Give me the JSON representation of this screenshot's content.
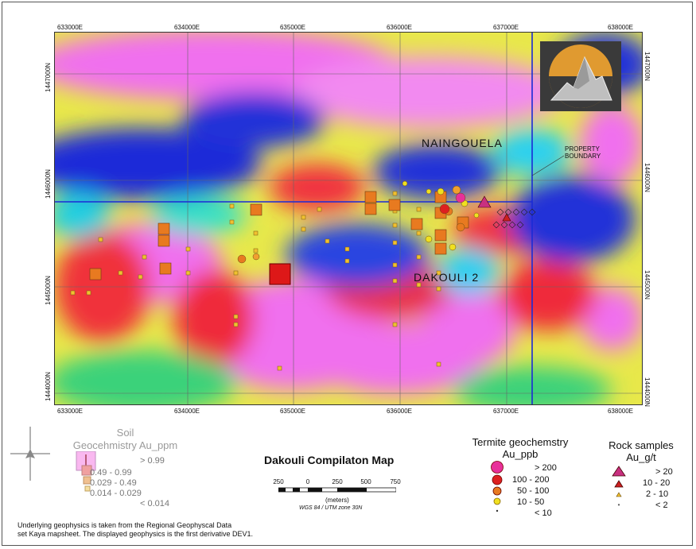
{
  "map": {
    "title": "Dakouli Compilaton Map",
    "eastings_top": [
      "633000E",
      "634000E",
      "635000E",
      "636000E",
      "637000E",
      "638000E"
    ],
    "eastings_bottom": [
      "633000E",
      "634000E",
      "635000E",
      "636000E",
      "637000E",
      "638000E"
    ],
    "northings_left": [
      "1447000N",
      "1446000N",
      "1445000N",
      "1444000N"
    ],
    "northings_right": [
      "1447000N",
      "1446000N",
      "1445000N",
      "1444000N"
    ],
    "place_names": {
      "naingouela": "NAINGOUELA",
      "dakouli": "DAKOULI 2"
    },
    "property_boundary_label": [
      "PROPERTY",
      "BOUNDARY"
    ],
    "colors": {
      "boundary": "#1a2bd6",
      "geophysics_high": "#f26ef0",
      "geophysics_low": "#2030d8"
    }
  },
  "legend": {
    "soil": {
      "title_line1": "Soil",
      "title_line2": "Geocehmistry Au_ppm",
      "classes": [
        "> 0.99",
        "0.49 - 0.99",
        "0.029 - 0.49",
        "0.014 - 0.029",
        "< 0.014"
      ]
    },
    "termite": {
      "title_line1": "Termite geochemstry",
      "title_line2": "Au_ppb",
      "classes": [
        "> 200",
        "100 - 200",
        "50 - 100",
        "10 - 50",
        "< 10"
      ]
    },
    "rock": {
      "title_line1": "Rock samples",
      "title_line2": "Au_g/t",
      "classes": [
        "> 20",
        "10 - 20",
        "2 - 10",
        "< 2"
      ]
    }
  },
  "scale_bar": {
    "labels": [
      "250",
      "0",
      "250",
      "500",
      "750"
    ],
    "units": "(meters)",
    "projection": "WGS 84 / UTM zone 30N"
  },
  "note": {
    "line1": "Underlying geophysics is taken from the Regional Geophyscal Data",
    "line2": "set Kaya mapsheet.  The displayed geophysics is the first derivative DEV1."
  }
}
